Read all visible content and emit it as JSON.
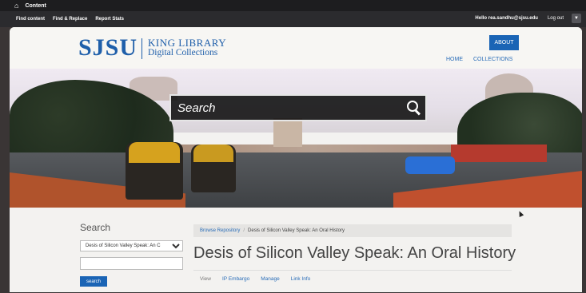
{
  "topbar": {
    "home_icon": "home-icon",
    "content_label": "Content"
  },
  "toolbar": {
    "links": [
      "Find content",
      "Find & Replace",
      "Report Stats"
    ],
    "greeting": "Hello rea.sandhu@sjsu.edu",
    "logout": "Log out"
  },
  "header": {
    "logo_main": "SJSU",
    "logo_line1": "KING LIBRARY",
    "logo_line2": "Digital Collections",
    "about": "ABOUT",
    "nav": [
      "HOME",
      "COLLECTIONS"
    ]
  },
  "hero": {
    "search_placeholder": "Search",
    "search_icon": "search-icon"
  },
  "sidebar": {
    "title": "Search",
    "select_value": "Desis of Silicon Valley Speak: An C",
    "input_value": "",
    "button_label": "search"
  },
  "main": {
    "breadcrumb": [
      "Browse Repository",
      "Desis of Silicon Valley Speak: An Oral History"
    ],
    "title": "Desis of Silicon Valley Speak: An Oral History",
    "tabs": [
      "View",
      "IP Embargo",
      "Manage",
      "Link Info"
    ]
  },
  "colors": {
    "brand_blue": "#1f5faa",
    "button_blue": "#1a64b5"
  }
}
